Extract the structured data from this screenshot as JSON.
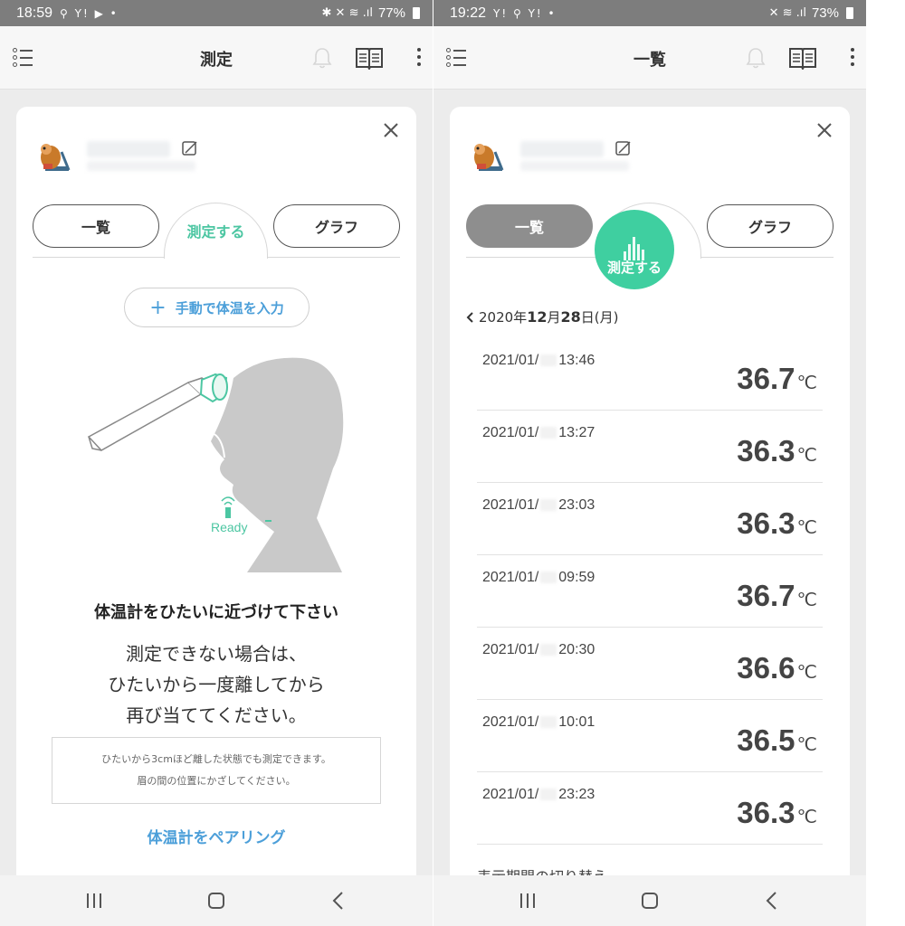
{
  "left": {
    "status": {
      "time": "18:59",
      "notif": "⚲ Y! ▶ •",
      "icons": "✱ ✕ ≋ .ıl",
      "battery": "77%"
    },
    "header": {
      "title": "測定"
    },
    "tabs": {
      "list": "一覧",
      "measure": "測定する",
      "graph": "グラフ"
    },
    "manual_input": "手動で体温を入力",
    "ready_label": "Ready",
    "instruction_title": "体温計をひたいに近づけて下さい",
    "instruction_lines": [
      "測定できない場合は、",
      "ひたいから一度離してから",
      "再び当ててください。"
    ],
    "note_lines": [
      "ひたいから3cmほど離した状態でも測定できます。",
      "眉の間の位置にかざしてください。"
    ],
    "pair_link": "体温計をペアリング"
  },
  "right": {
    "status": {
      "time": "19:22",
      "notif": "Y! ⚲ Y! •",
      "icons": "✕ ≋ .ıl",
      "battery": "73%"
    },
    "header": {
      "title": "一覧"
    },
    "tabs": {
      "list": "一覧",
      "measure": "測定する",
      "graph": "グラフ"
    },
    "date_nav": {
      "prefix": "2020年",
      "month": "12",
      "mid": "月",
      "day": "28",
      "suffix": "日(月)"
    },
    "records": [
      {
        "date": "2021/01/",
        "time": "13:46",
        "temp": "36.7",
        "unit": "℃"
      },
      {
        "date": "2021/01/",
        "time": "13:27",
        "temp": "36.3",
        "unit": "℃"
      },
      {
        "date": "2021/01/",
        "time": "23:03",
        "temp": "36.3",
        "unit": "℃"
      },
      {
        "date": "2021/01/",
        "time": "09:59",
        "temp": "36.7",
        "unit": "℃"
      },
      {
        "date": "2021/01/",
        "time": "20:30",
        "temp": "36.6",
        "unit": "℃"
      },
      {
        "date": "2021/01/",
        "time": "10:01",
        "temp": "36.5",
        "unit": "℃"
      },
      {
        "date": "2021/01/",
        "time": "23:23",
        "temp": "36.3",
        "unit": "℃"
      }
    ],
    "period_toggle": "表示期間の切り替え"
  },
  "colors": {
    "accent_green": "#4cc6a2",
    "link_blue": "#4c9fd9",
    "fab_green": "#3fcfa0"
  }
}
